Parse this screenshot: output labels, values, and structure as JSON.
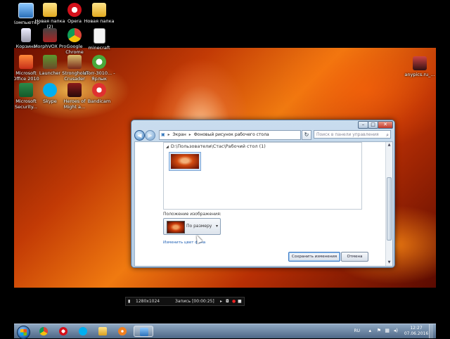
{
  "desktop": {
    "icons": [
      {
        "label": "Компьютер",
        "icon": "computer-icon"
      },
      {
        "label": "Новая папка (2)",
        "icon": "folder-icon"
      },
      {
        "label": "Opera",
        "icon": "opera-icon"
      },
      {
        "label": "Новая папка",
        "icon": "folder-icon"
      },
      {
        "label": "Корзина",
        "icon": "recycle-bin-icon"
      },
      {
        "label": "MorphVOX Pro",
        "icon": "morphvox-icon"
      },
      {
        "label": "Google Chrome",
        "icon": "chrome-icon"
      },
      {
        "label": "minecraft",
        "icon": "document-icon"
      },
      {
        "label": "Microsoft Office 2010",
        "icon": "office-icon"
      },
      {
        "label": "Launcher",
        "icon": "minecraft-launcher-icon"
      },
      {
        "label": "Stronghold Crusader",
        "icon": "stronghold-icon"
      },
      {
        "label": "uTorr-3010... - Ярлык",
        "icon": "utorrent-icon"
      },
      {
        "label": "Microsoft Security...",
        "icon": "security-icon"
      },
      {
        "label": "Skype",
        "icon": "skype-icon"
      },
      {
        "label": "Heroes of Might a...",
        "icon": "heroes-icon"
      },
      {
        "label": "Bandicam",
        "icon": "bandicam-icon"
      },
      {
        "label": "anypics.ru_...",
        "icon": "image-file-icon"
      }
    ]
  },
  "window": {
    "address": {
      "part1": "Экран",
      "part2": "Фоновый рисунок рабочего стола"
    },
    "search_placeholder": "Поиск в панели управления",
    "group_header": "D:\\Пользователи\\Стас\\Рабочий стол (1)",
    "position_label": "Положение изображения:",
    "position_value": "По размеру",
    "change_color_link": "Изменить цвет фона",
    "save_button": "Сохранить изменения",
    "cancel_button": "Отмена"
  },
  "recorder": {
    "resolution": "1280x1024",
    "record_status": "Запись [00:00:25]"
  },
  "taskbar": {
    "apps": [
      "chrome-icon",
      "opera-icon",
      "skype-icon",
      "explorer-icon",
      "media-player-icon",
      "control-panel-icon"
    ],
    "language": "RU",
    "time": "12:27",
    "date": "07.06.2016"
  }
}
